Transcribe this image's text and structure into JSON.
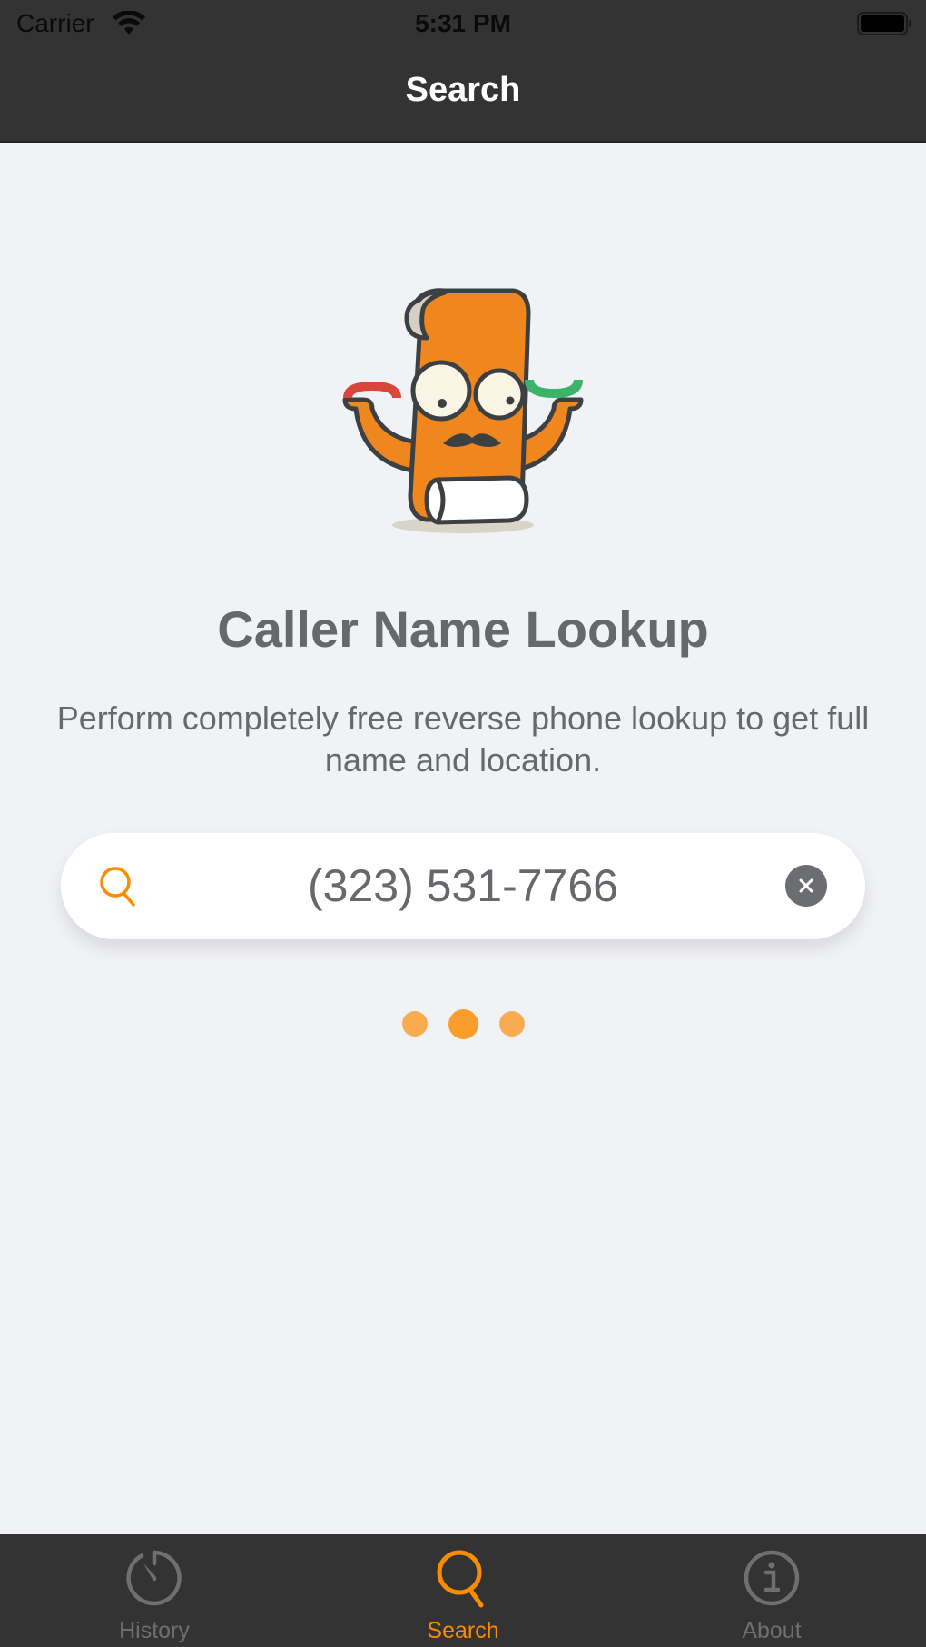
{
  "status_bar": {
    "carrier": "Carrier",
    "time": "5:31 PM",
    "wifi_icon": "wifi-icon",
    "battery_icon": "battery-icon"
  },
  "nav": {
    "title": "Search"
  },
  "main": {
    "mascot": "scroll-mascot-with-phones-illustration",
    "title": "Caller Name Lookup",
    "description": "Perform completely free reverse phone lookup to get full name and location.",
    "search": {
      "icon": "search-icon",
      "value": "(323) 531-7766",
      "placeholder": "",
      "clear_icon": "clear-icon"
    },
    "loading_indicator": {
      "dots": 3,
      "active_dot": 2
    }
  },
  "tabbar": {
    "tabs": [
      {
        "label": "History",
        "icon": "stopwatch-icon",
        "active": false
      },
      {
        "label": "Search",
        "icon": "search-icon",
        "active": true
      },
      {
        "label": "About",
        "icon": "info-icon",
        "active": false
      }
    ]
  },
  "colors": {
    "accent": "#fb8c00",
    "bar_background": "#333333",
    "page_background": "#f1f2f6",
    "text_gray": "#67686c",
    "inactive_tab": "#6f6f72"
  }
}
